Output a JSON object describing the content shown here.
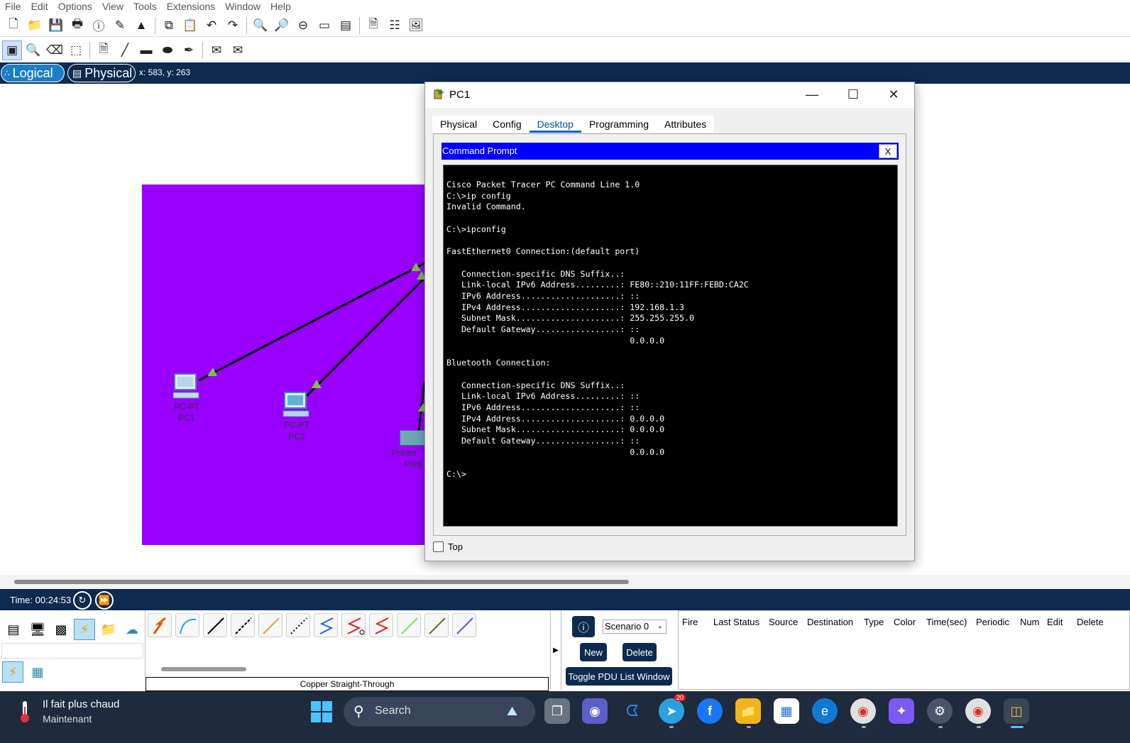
{
  "menu": [
    "File",
    "Edit",
    "Options",
    "View",
    "Tools",
    "Extensions",
    "Window",
    "Help"
  ],
  "modebar": {
    "logical_label": "Logical",
    "physical_label": "Physical",
    "coords": "x: 583, y: 263"
  },
  "workspace": {
    "devices": [
      {
        "type": "PC-PT",
        "name": "PC1"
      },
      {
        "type": "PC-PT",
        "name": "PC2"
      },
      {
        "type": "Printer",
        "name": "Print"
      }
    ]
  },
  "dialog": {
    "title": "PC1",
    "tabs": [
      "Physical",
      "Config",
      "Desktop",
      "Programming",
      "Attributes"
    ],
    "active_tab": "Desktop",
    "app_title": "Command Prompt",
    "close_label": "X",
    "terminal_text": "Cisco Packet Tracer PC Command Line 1.0\nC:\\>ip config\nInvalid Command.\n\nC:\\>ipconfig\n\nFastEthernet0 Connection:(default port)\n\n   Connection-specific DNS Suffix..:\n   Link-local IPv6 Address.........: FE80::210:11FF:FEBD:CA2C\n   IPv6 Address....................: ::\n   IPv4 Address....................: 192.168.1.3\n   Subnet Mask.....................: 255.255.255.0\n   Default Gateway.................: ::\n                                     0.0.0.0\n\nBluetooth Connection:\n\n   Connection-specific DNS Suffix..:\n   Link-local IPv6 Address.........: ::\n   IPv6 Address....................: ::\n   IPv4 Address....................: 0.0.0.0\n   Subnet Mask.....................: 0.0.0.0\n   Default Gateway.................: ::\n                                     0.0.0.0\n\nC:\\>",
    "top_checkbox_label": "Top"
  },
  "bottom": {
    "time": "Time: 00:24:53",
    "cable_label": "Copper Straight-Through",
    "scenario": "Scenario 0",
    "new_label": "New",
    "delete_label": "Delete",
    "toggle_label": "Toggle PDU List Window",
    "pdu_columns": [
      "Fire",
      "Last Status",
      "Source",
      "Destination",
      "Type",
      "Color",
      "Time(sec)",
      "Periodic",
      "Num",
      "Edit",
      "Delete"
    ]
  },
  "taskbar": {
    "weather_title": "Il fait plus chaud",
    "weather_sub": "Maintenant",
    "search_label": "Search",
    "telegram_badge": "20"
  },
  "colors": {
    "purple_area": "#9900ff",
    "navy_bar": "#0d2a4f",
    "cmd_header": "#0000ff"
  }
}
